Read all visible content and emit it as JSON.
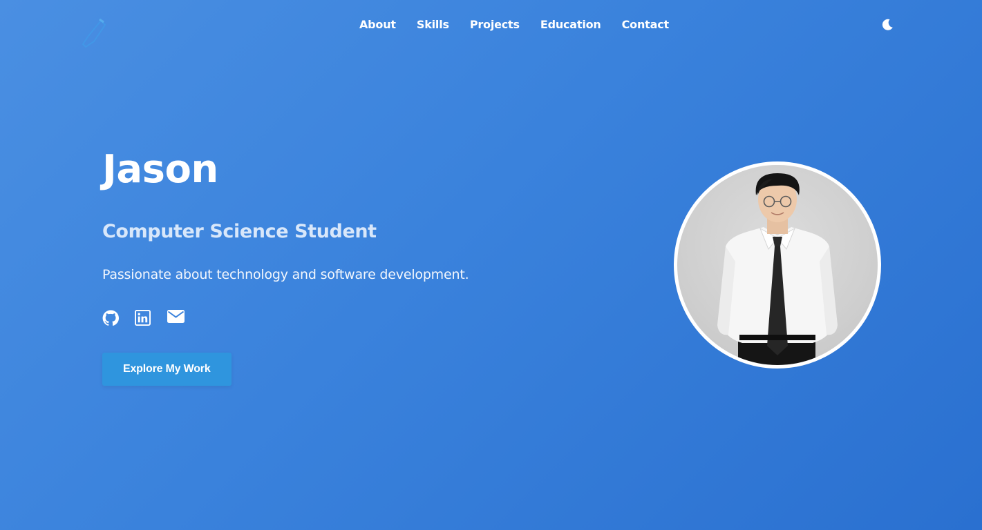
{
  "nav": {
    "links": [
      "About",
      "Skills",
      "Projects",
      "Education",
      "Contact"
    ],
    "logo_icon": "js-logo-icon",
    "theme_icon": "moon-icon"
  },
  "hero": {
    "name": "Jason",
    "role": "Computer Science Student",
    "description": "Passionate about technology and software development.",
    "cta_label": "Explore My Work",
    "socials": [
      "github-icon",
      "linkedin-icon",
      "envelope-icon"
    ],
    "avatar_icon": "profile-photo"
  },
  "colors": {
    "background_start": "#4a8fe2",
    "background_end": "#2a70d0",
    "button": "#2f95de",
    "role_text": "#d8e7fa"
  }
}
